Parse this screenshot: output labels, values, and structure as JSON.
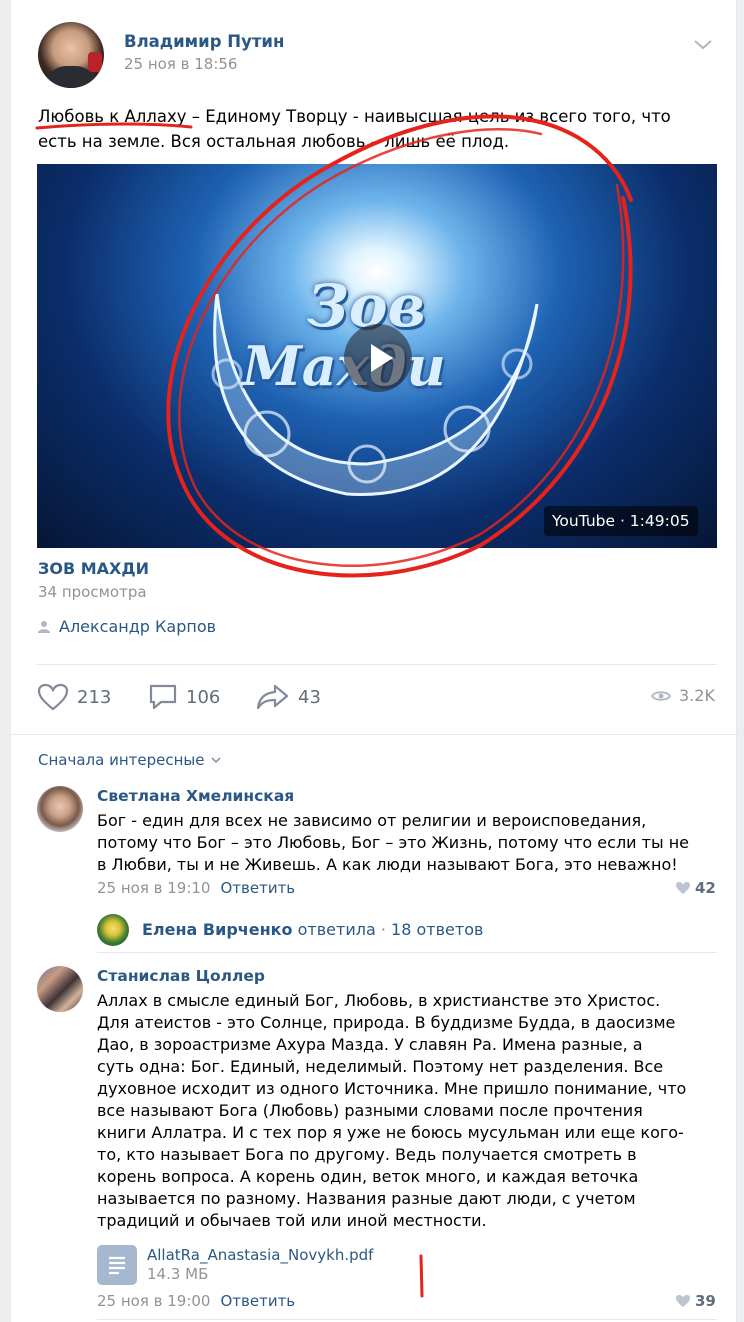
{
  "post": {
    "author": "Владимир Путин",
    "date": "25 ноя в 18:56",
    "text_line1": "Любовь к Аллаху – Единому Творцу - наивысшая цель из всего того, что",
    "text_line2": "есть на земле. Вся остальная любовь – лишь её плод.",
    "video": {
      "title_art_line1": "Зов",
      "title_art_line2": "Махди",
      "badge": "YouTube · 1:49:05",
      "title": "ЗОВ МАХДИ",
      "views": "34 просмотра"
    },
    "signer": "Александр Карпов",
    "likes": "213",
    "comments": "106",
    "shares": "43",
    "views": "3.2K"
  },
  "comments_section": {
    "sort_label": "Сначала интересные"
  },
  "comments": [
    {
      "author": "Светлана Хмелинская",
      "lines": [
        "Бог - един для всех не зависимо от религии и вероисповедания,",
        "потому что Бог – это Любовь, Бог – это Жизнь, потому что если ты не",
        "в Любви, ты и не Живешь. А как люди называют Бога, это неважно!"
      ],
      "date": "25 ноя в 19:10",
      "reply_label": "Ответить",
      "likes": "42",
      "thread": {
        "author": "Елена Вирченко",
        "action": "ответила",
        "count": "18 ответов"
      }
    },
    {
      "author": "Станислав Цоллер",
      "lines": [
        "Аллах в смысле единый Бог, Любовь, в христианстве это Христос.",
        "Для атеистов - это Солнце, природа. В буддизме Будда, в даосизме",
        "Дао, в зороастризме Ахура Мазда. У славян Ра. Имена разные, а",
        "суть одна: Бог. Единый, неделимый. Поэтому нет разделения. Все",
        "духовное исходит из одного Источника. Мне пришло понимание, что",
        "все называют Бога (Любовь) разными словами после прочтения",
        "книги Аллатра. И с тех пор я уже не боюсь мусульман или еще кого-",
        "то, кто называет Бога по другому. Ведь получается смотреть в",
        "корень вопроса. А корень один, веток много, и каждая веточка",
        "называется по разному. Названия разные дают люди, с учетом",
        "традиций и обычаев той или иной местности."
      ],
      "attachment": {
        "name": "AllatRa_Anastasia_Novykh.pdf",
        "size": "14.3 МБ"
      },
      "date": "25 ноя в 19:00",
      "reply_label": "Ответить",
      "likes": "39"
    }
  ],
  "colors": {
    "link": "#2a5885",
    "annotation": "#e5231c",
    "muted": "#939393"
  }
}
